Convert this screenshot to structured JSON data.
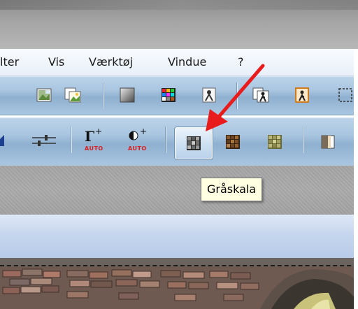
{
  "menubar": {
    "items": [
      {
        "label": "lter"
      },
      {
        "label": "Vis"
      },
      {
        "label": "Værktøj"
      },
      {
        "label": "Vindue"
      },
      {
        "label": "?"
      }
    ]
  },
  "toolbar2": {
    "auto_label_1": "AUTO",
    "auto_label_2": "AUTO",
    "gamma_symbol": "Γ",
    "plus_symbol": "+"
  },
  "tooltip": {
    "text": "Gråskala"
  },
  "colors": {
    "arrow": "#e81c1c",
    "auto_text": "#d81e1e",
    "tooltip_bg": "#ffffe1",
    "toolbar_blue": "#a9c5e0"
  },
  "icons": [
    "image-scan-icon",
    "landscape-image-icon",
    "copy-image-icon",
    "gray-gradient-icon",
    "color-palette-icon",
    "image-effect-icon",
    "person-frame-icon",
    "person-frame-orange-icon",
    "selection-rect-icon",
    "brightness-icon",
    "levels-sliders-icon",
    "gamma-auto-icon",
    "contrast-auto-icon",
    "grayscale-icon",
    "sepia-icon",
    "olive-tint-icon",
    "color-balance-icon"
  ]
}
